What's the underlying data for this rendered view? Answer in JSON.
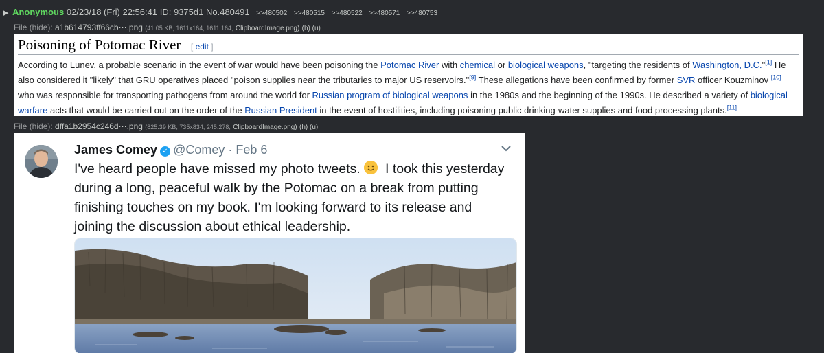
{
  "post": {
    "arrow": "▶",
    "name": "Anonymous",
    "datetime": "02/23/18 (Fri) 22:56:41",
    "id_label": "ID:",
    "id_value": "9375d1",
    "number": "No.480491",
    "backlinks": [
      ">>480502",
      ">>480515",
      ">>480522",
      ">>480571",
      ">>480753"
    ]
  },
  "files": [
    {
      "label": "File",
      "hide": "(hide):",
      "name": "a1b614793ff66cb⋯.png",
      "meta": "(41.05 KB, 1611x164, 1611:164,",
      "orig": "ClipboardImage.png)",
      "links": "(h) (u)"
    },
    {
      "label": "File",
      "hide": "(hide):",
      "name": "dffa1b2954c246d⋯.png",
      "meta": "(825.39 KB, 735x834, 245:278,",
      "orig": "ClipboardImage.png)",
      "links": "(h) (u)"
    }
  ],
  "wiki": {
    "title": "Poisoning of Potomac River",
    "edit_open": "[",
    "edit_label": "edit",
    "edit_close": "]",
    "p1": "According to Lunev, a probable scenario in the event of war would have been poisoning the",
    "l_potomac": "Potomac River",
    "p2": "with",
    "l_chemical": "chemical",
    "p3": "or",
    "l_bio": "biological weapons",
    "p4": ", \"targeting the residents of",
    "l_dc": "Washington, D.C.",
    "p5": "\"",
    "ref1": "[1]",
    "p6": "He also considered it \"likely\" that GRU operatives placed \"poison supplies near the tributaries to major US reservoirs.\"",
    "ref9": "[9]",
    "p7": "These allegations have been confirmed by former",
    "l_svr": "SVR",
    "p8": "officer Kouzminov",
    "ref10": "[10]",
    "p9": "who was responsible for transporting pathogens from around the world for",
    "l_rusbio": "Russian program of biological weapons",
    "p10": "in the 1980s and the beginning of the 1990s. He described a variety of",
    "l_warfare": "biological warfare",
    "p11": "acts that would be carried out on the order of the",
    "l_president": "Russian President",
    "p12": "in the event of hostilities, including poisoning public drinking-water supplies and food processing plants.",
    "ref11": "[11]"
  },
  "tweet": {
    "name": "James Comey",
    "handle": "@Comey",
    "dot": "·",
    "date": "Feb 6",
    "text_before_emoji": "I've heard people have missed my photo tweets.",
    "text_after_emoji": "I took this yesterday during a long, peaceful walk by the Potomac on a break from putting finishing touches on my book. I'm looking forward to its release and joining the discussion about ethical leadership.",
    "emoji_name": "slightly-smiling-face-icon",
    "verified_icon": "verified-badge-icon",
    "chevron_icon": "chevron-down-icon"
  },
  "colors": {
    "background": "#282a2e",
    "name_green": "#5fd75f",
    "wiki_link": "#0645ad",
    "twitter_blue": "#1da1f2"
  }
}
